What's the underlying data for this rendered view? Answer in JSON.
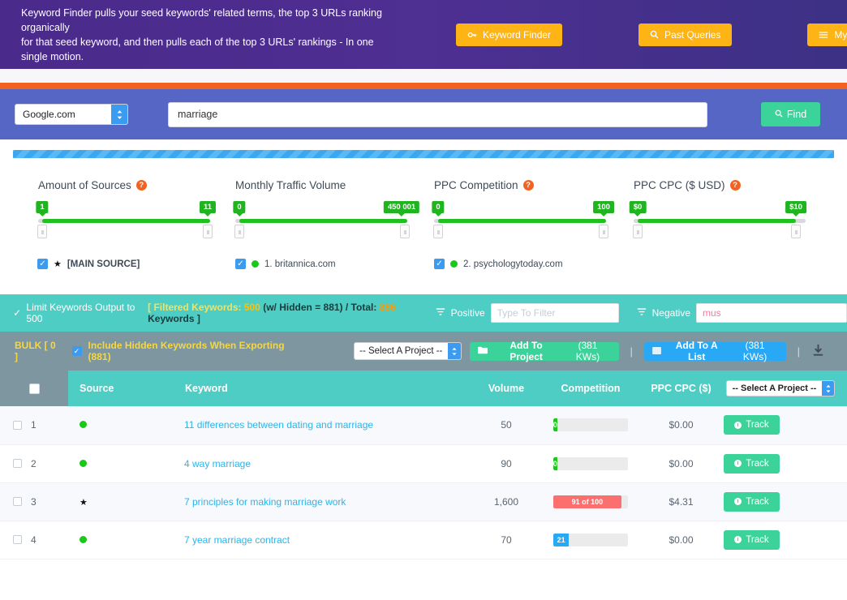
{
  "banner": {
    "description_line1": "Keyword Finder pulls your seed keywords' related terms, the top 3 URLs ranking organically",
    "description_line2": "for that seed keyword, and then pulls each of the top 3 URLs' rankings - In one single motion.",
    "buttons": [
      {
        "label": "Keyword Finder",
        "icon": "key-icon"
      },
      {
        "label": "Past Queries",
        "icon": "search-icon"
      },
      {
        "label": "My Lists",
        "icon": "list-icon"
      }
    ]
  },
  "search": {
    "engine": "Google.com",
    "query": "marriage",
    "placeholder": "",
    "find_label": "Find"
  },
  "filters": [
    {
      "title": "Amount of Sources",
      "has_help": true,
      "min_label": "1",
      "max_label": "11",
      "fill_start_pct": 2,
      "fill_end_pct": 100
    },
    {
      "title": "Monthly Traffic Volume",
      "has_help": false,
      "min_label": "0",
      "max_label": "450 001",
      "fill_start_pct": 2,
      "fill_end_pct": 100
    },
    {
      "title": "PPC Competition",
      "has_help": true,
      "min_label": "0",
      "max_label": "100",
      "fill_start_pct": 2,
      "fill_end_pct": 100
    },
    {
      "title": "PPC CPC ($ USD)",
      "has_help": true,
      "min_label": "$0",
      "max_label": "$10",
      "fill_start_pct": 2,
      "fill_end_pct": 94
    }
  ],
  "sources": [
    {
      "checked": true,
      "marker": "star",
      "label": "[MAIN SOURCE]",
      "bold": true
    },
    {
      "checked": true,
      "marker": "dot",
      "label": "1. britannica.com",
      "bold": false
    },
    {
      "checked": true,
      "marker": "dot",
      "label": "2. psychologytoday.com",
      "bold": false
    }
  ],
  "teal_bar": {
    "limit_label": "Limit Keywords Output to 500",
    "limit_checked": true,
    "counts_prefix": "[ Filtered Keywords: ",
    "filtered_count": "500",
    "hidden_text": " (w/ Hidden = 881) / Total: ",
    "total_count": "886",
    "counts_suffix": " Keywords ]",
    "positive_label": "Positive",
    "positive_placeholder": "Type To Filter",
    "positive_value": "",
    "negative_label": "Negative",
    "negative_placeholder": "",
    "negative_value": "mus"
  },
  "bulk_bar": {
    "bulk_label": "BULK [ 0 ]",
    "include_hidden_label": "Include Hidden Keywords When Exporting (881)",
    "include_hidden_checked": true,
    "project_select": "-- Select A Project --",
    "add_to_project_label": "Add To Project",
    "add_to_project_count": "(381 KWs)",
    "add_to_list_label": "Add To A List",
    "add_to_list_count": "(381 KWs)",
    "download_icon": "download-icon"
  },
  "table": {
    "headers": {
      "source": "Source",
      "keyword": "Keyword",
      "volume": "Volume",
      "competition": "Competition",
      "cpc": "PPC CPC ($)",
      "project_select": "-- Select A Project --"
    },
    "rows": [
      {
        "num": "1",
        "marker": "dot",
        "keyword": "11 differences between dating and marriage",
        "volume": "50",
        "comp_label": "0",
        "comp_pct": 5,
        "comp_color": "#19c819",
        "cpc": "$0.00",
        "track_label": "Track"
      },
      {
        "num": "2",
        "marker": "dot",
        "keyword": "4 way marriage",
        "volume": "90",
        "comp_label": "0",
        "comp_pct": 5,
        "comp_color": "#19c819",
        "cpc": "$0.00",
        "track_label": "Track"
      },
      {
        "num": "3",
        "marker": "star",
        "keyword": "7 principles for making marriage work",
        "volume": "1,600",
        "comp_label": "91 of 100",
        "comp_pct": 91,
        "comp_color": "#fc6f6f",
        "cpc": "$4.31",
        "track_label": "Track"
      },
      {
        "num": "4",
        "marker": "dot",
        "keyword": "7 year marriage contract",
        "volume": "70",
        "comp_label": "21",
        "comp_pct": 21,
        "comp_color": "#29a9f5",
        "cpc": "$0.00",
        "track_label": "Track"
      }
    ]
  },
  "colors": {
    "banner_purple": "#4a2a8a",
    "orange_accent": "#f26322",
    "yellow_button": "#fdb414",
    "search_blue": "#5566c4",
    "teal": "#4ecdc4",
    "slate": "#7d96a0",
    "green": "#3cd39a",
    "link_blue": "#2db4e8"
  }
}
